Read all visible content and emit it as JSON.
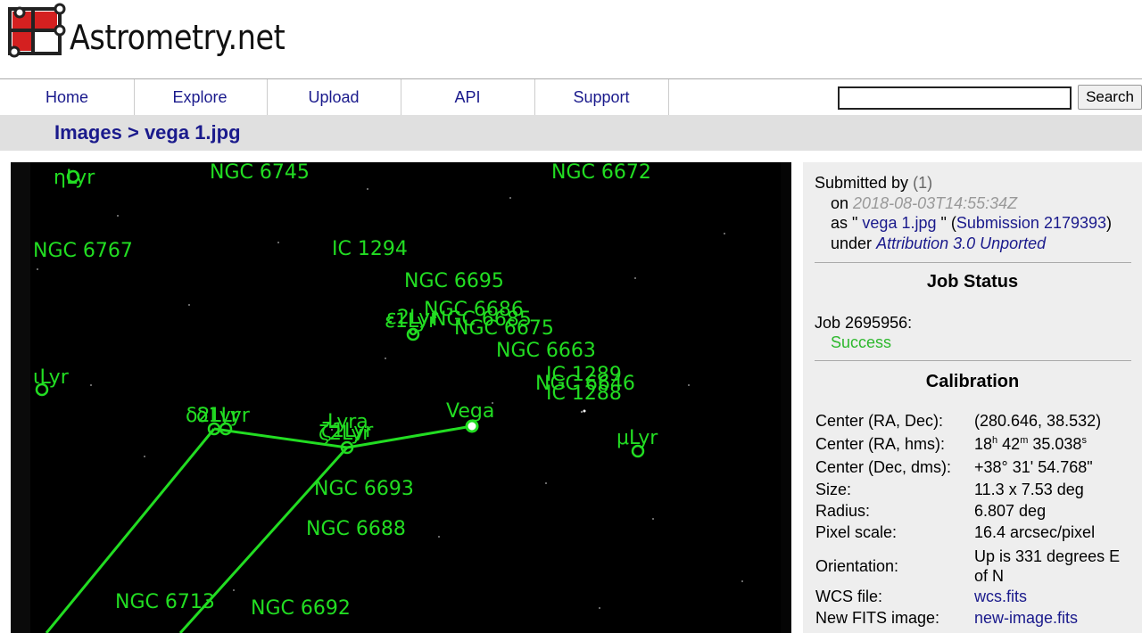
{
  "logo": {
    "text": "Astrometry.net"
  },
  "nav": {
    "items": [
      "Home",
      "Explore",
      "Upload",
      "API",
      "Support"
    ],
    "search_placeholder": "",
    "search_label": "Search"
  },
  "breadcrumb": {
    "root": "Images",
    "separator": ">",
    "current": "vega 1.jpg"
  },
  "sky_labels": [
    "ηLyr",
    "NGC 6745",
    "NGC 6672",
    "NGC 6767",
    "IC 1294",
    "NGC 6695",
    "NGC 6686",
    "ε1Lyr",
    "ε2Lyr",
    "NGC 6685",
    "NGC 6675",
    "NGC 6663",
    "IC 1289",
    "NGC 6646",
    "IC 1288",
    "ιLyr",
    "δ2Lyr",
    "δ1Lyr",
    "Lyra",
    "ζ2Lyr",
    "ζ1Lyr",
    "Vega",
    "μLyr",
    "NGC 6693",
    "NGC 6688",
    "NGC 6713",
    "NGC 6692"
  ],
  "submission": {
    "submitted_by": "Submitted by",
    "user": "(1)",
    "on": "on",
    "date": "2018-08-03T14:55:34Z",
    "as_prefix": "as \"",
    "filename": "vega 1.jpg",
    "as_suffix": "\" (",
    "submission_link": "Submission 2179393",
    "close_paren": ")",
    "under": "under",
    "license": "Attribution 3.0 Unported"
  },
  "job_status": {
    "title": "Job Status",
    "job": "Job 2695956:",
    "status": "Success"
  },
  "calibration": {
    "title": "Calibration",
    "center_radec_label": "Center (RA, Dec):",
    "center_radec": "(280.646, 38.532)",
    "center_hms_label": "Center (RA, hms):",
    "hms_h": "18",
    "hms_m": "42",
    "hms_s": "35.038",
    "center_dms_label": "Center (Dec, dms):",
    "center_dms": "+38° 31' 54.768\"",
    "size_label": "Size:",
    "size": "11.3 x 7.53 deg",
    "radius_label": "Radius:",
    "radius": "6.807 deg",
    "pixel_scale_label": "Pixel scale:",
    "pixel_scale": "16.4 arcsec/pixel",
    "orientation_label": "Orientation:",
    "orientation": "Up is 331 degrees E of N",
    "wcs_label": "WCS file:",
    "wcs": "wcs.fits",
    "fits_label": "New FITS image:",
    "fits": "new-image.fits"
  },
  "colors": {
    "link": "#1a1a8c",
    "success": "#2db82d",
    "overlay": "#22dd22",
    "logo_red": "#d42020"
  }
}
